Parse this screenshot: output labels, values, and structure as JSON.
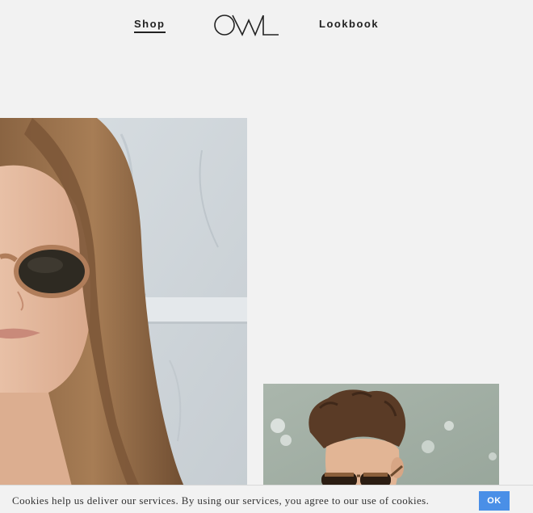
{
  "nav": {
    "shop_label": "Shop",
    "lookbook_label": "Lookbook",
    "logo_text": "OWL"
  },
  "colors": {
    "page_background": "#f2f2f2",
    "nav_text": "#222222",
    "ok_button": "#4a8fe7"
  },
  "photos": [
    {
      "name": "model-woman-sunglasses",
      "alt": "Woman wearing round tinted sunglasses"
    },
    {
      "name": "model-man-sunglasses",
      "alt": "Man with curly hair wearing sunglasses"
    }
  ],
  "cookie_bar": {
    "message": "Cookies help us deliver our services. By using our services, you agree to our use of cookies.",
    "ok_label": "OK"
  }
}
